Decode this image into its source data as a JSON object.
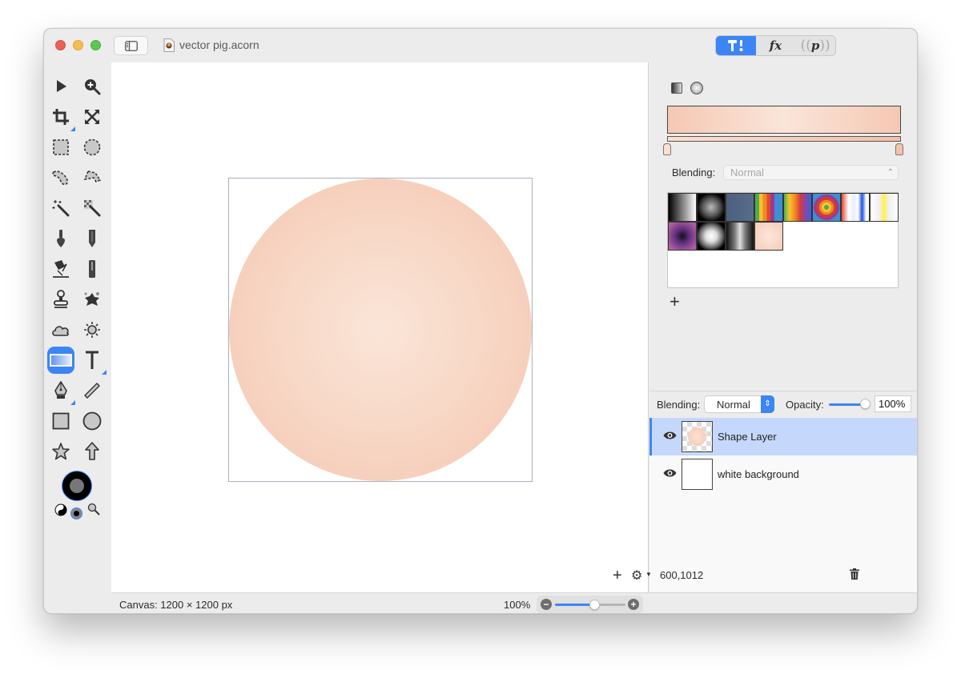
{
  "window": {
    "title": "vector pig.acorn"
  },
  "toolbar": {
    "segments": [
      {
        "name": "tools",
        "icon": "hammer-brush-icon",
        "active": true
      },
      {
        "name": "effects",
        "label": "fx",
        "active": false
      },
      {
        "name": "palette",
        "label": "p",
        "active": false
      }
    ]
  },
  "tools": [
    {
      "name": "select-arrow",
      "icon": "arrow-pointer-icon"
    },
    {
      "name": "zoom",
      "icon": "zoom-in-icon"
    },
    {
      "name": "crop",
      "icon": "crop-icon"
    },
    {
      "name": "resize",
      "icon": "expand-arrows-icon"
    },
    {
      "name": "rect-select",
      "icon": "dashed-rect-icon"
    },
    {
      "name": "ellipse-select",
      "icon": "dashed-circle-icon"
    },
    {
      "name": "lasso",
      "icon": "lasso-icon"
    },
    {
      "name": "polygon-lasso",
      "icon": "polygon-lasso-icon"
    },
    {
      "name": "magic-wand",
      "icon": "magic-wand-icon"
    },
    {
      "name": "instant-alpha",
      "icon": "instant-alpha-icon"
    },
    {
      "name": "brush",
      "icon": "brush-icon"
    },
    {
      "name": "pencil",
      "icon": "pencil-icon"
    },
    {
      "name": "paint-bucket",
      "icon": "paint-bucket-icon"
    },
    {
      "name": "eraser",
      "icon": "eraser-icon"
    },
    {
      "name": "clone-stamp",
      "icon": "stamp-icon"
    },
    {
      "name": "smudge",
      "icon": "splatter-icon"
    },
    {
      "name": "blur",
      "icon": "cloud-icon"
    },
    {
      "name": "dodge-burn",
      "icon": "sun-icon"
    },
    {
      "name": "gradient",
      "icon": "gradient-icon",
      "selected": true
    },
    {
      "name": "text",
      "icon": "text-icon"
    },
    {
      "name": "bezier-pen",
      "icon": "pen-nib-icon"
    },
    {
      "name": "line",
      "icon": "line-icon"
    },
    {
      "name": "rectangle",
      "icon": "rectangle-icon"
    },
    {
      "name": "oval",
      "icon": "circle-icon"
    },
    {
      "name": "star",
      "icon": "star-icon"
    },
    {
      "name": "arrow",
      "icon": "up-arrow-icon"
    }
  ],
  "colors": {
    "accent": "#3b85f5",
    "gradient_start": "#f5c8b3",
    "gradient_mid": "#fae5d9",
    "gradient_end": "#f5c8b3"
  },
  "inspector": {
    "blending_label": "Blending:",
    "blending_value": "Normal",
    "presets": [
      {
        "name": "black-white-linear"
      },
      {
        "name": "black-radial"
      },
      {
        "name": "slate-blue"
      },
      {
        "name": "rainbow-stripes"
      },
      {
        "name": "spectrum"
      },
      {
        "name": "rainbow-radial"
      },
      {
        "name": "red-blue-transparent"
      },
      {
        "name": "yellow-transparent"
      },
      {
        "name": "purple-radial"
      },
      {
        "name": "white-radial-dark"
      },
      {
        "name": "gray-transparent"
      },
      {
        "name": "peach-radial"
      }
    ],
    "add_preset_label": "+"
  },
  "layers": {
    "blending_label": "Blending:",
    "blending_value": "Normal",
    "opacity_label": "Opacity:",
    "opacity_value": "100%",
    "opacity_fraction": 1.0,
    "items": [
      {
        "name": "Shape Layer",
        "visible": true,
        "selected": true
      },
      {
        "name": "white background",
        "visible": true,
        "selected": false
      }
    ],
    "footer": {
      "add_label": "+",
      "coords": "600,1012"
    }
  },
  "status": {
    "canvas_size": "Canvas: 1200 × 1200 px",
    "zoom_level": "100%",
    "zoom_fraction": 0.56
  }
}
